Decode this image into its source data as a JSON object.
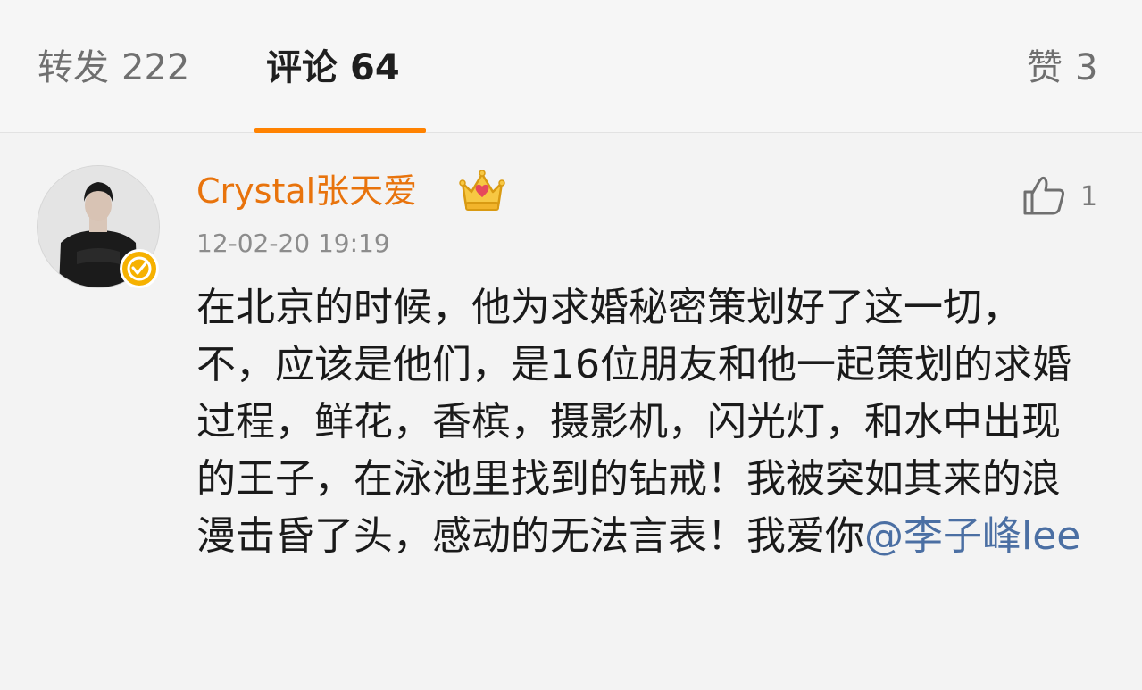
{
  "tabs": {
    "repost": {
      "label": "转发",
      "count": "222"
    },
    "comments": {
      "label": "评论",
      "count": "64"
    },
    "likes": {
      "label": "赞",
      "count": "3"
    }
  },
  "comment": {
    "username": "Crystal张天爱",
    "timestamp": "12-02-20 19:19",
    "like_count": "1",
    "text": "在北京的时候，他为求婚秘密策划好了这一切，不，应该是他们，是16位朋友和他一起策划的求婚过程，鲜花，香槟，摄影机，闪光灯，和水中出现的王子，在泳池里找到的钻戒！我被突如其来的浪漫击昏了头，感动的无法言表！我爱你",
    "mention": "@李子峰lee"
  },
  "colors": {
    "accent": "#ff8200",
    "username": "#e8730c",
    "mention": "#4b6fa3",
    "verified": "#f6b100"
  },
  "icons": {
    "verified": "verified-badge-icon",
    "member": "crown-badge-icon",
    "like": "thumbs-up-icon"
  }
}
